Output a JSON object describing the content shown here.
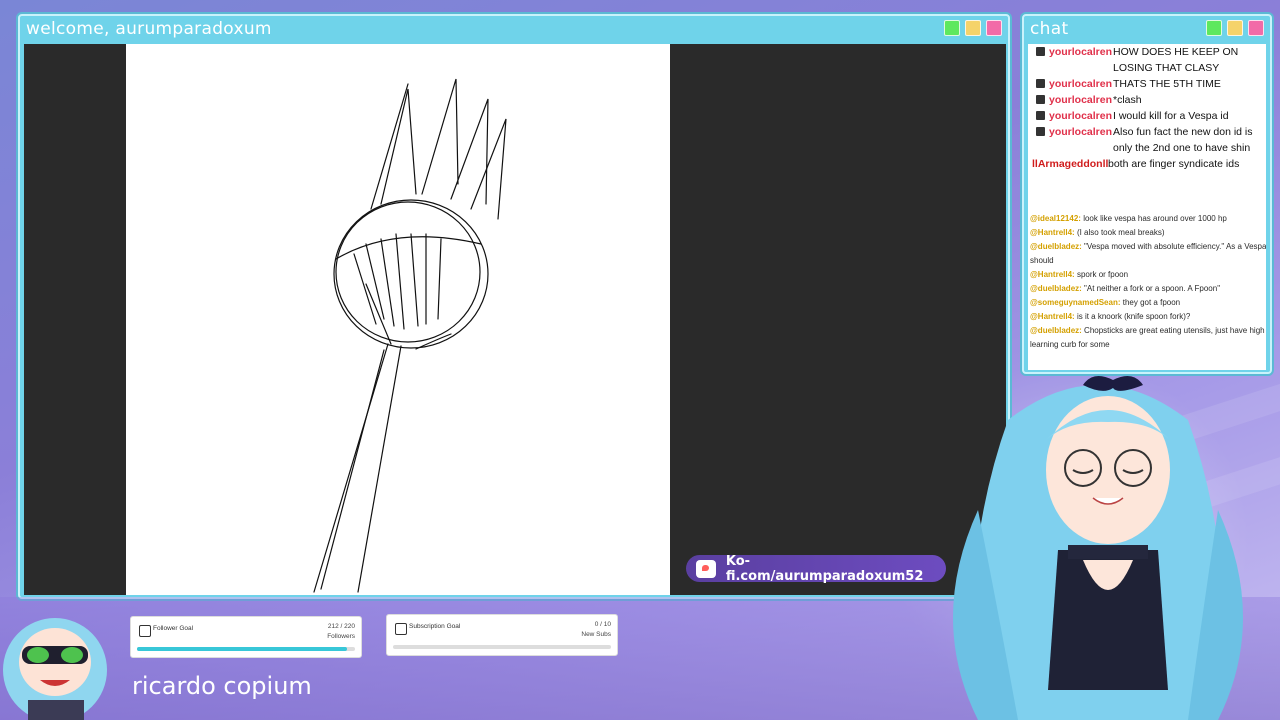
{
  "main_window": {
    "title": "welcome, aurumparadoxum"
  },
  "chat_window": {
    "title": "chat"
  },
  "chat": {
    "messages": [
      {
        "user": "yourlocalren",
        "text": "HOW DOES HE KEEP ON LOSING THAT CLASY"
      },
      {
        "user": "yourlocalren",
        "text": "THATS THE 5TH TIME"
      },
      {
        "user": "yourlocalren",
        "text": "*clash"
      },
      {
        "user": "yourlocalren",
        "text": "I would kill for a Vespa id"
      },
      {
        "user": "yourlocalren",
        "text": "Also fun fact the new don id is only the 2nd one to have shin"
      },
      {
        "user": "llArmageddonll",
        "text": "both are finger syndicate ids"
      }
    ],
    "fan_chat": [
      {
        "user": "@ideal12142:",
        "text": "look like vespa has around over 1000 hp"
      },
      {
        "user": "@Hantrell4:",
        "text": "(I also took meal breaks)"
      },
      {
        "user": "@duelbladez:",
        "text": "\"Vespa moved with absolute efficiency.\" As a Vespa should"
      },
      {
        "user": "@Hantrell4:",
        "text": "spork or fpoon"
      },
      {
        "user": "@duelbladez:",
        "text": "\"At neither a fork or a spoon. A Fpoon\""
      },
      {
        "user": "@someguynamedSean:",
        "text": "they got a fpoon"
      },
      {
        "user": "@Hantrell4:",
        "text": "is it a knoork (knife spoon fork)?"
      },
      {
        "user": "@duelbladez:",
        "text": "Chopsticks are great eating utensils, just have high learning curb for some"
      }
    ]
  },
  "kofi": {
    "text": "Ko-fi.com/aurumparadoxum52"
  },
  "goals": {
    "follower": {
      "label": "Follower Goal",
      "count": "212 / 220",
      "unit": "Followers",
      "progress": 0.964
    },
    "subscription": {
      "label": "Subscription Goal",
      "count": "0 / 10",
      "unit": "New Subs",
      "progress": 0.0
    }
  },
  "nickname": "ricardo copium",
  "colors": {
    "window_frame": "#6fd3ea",
    "accent_purple": "#6d4cc0",
    "goal_fill": "#38c7d8"
  }
}
